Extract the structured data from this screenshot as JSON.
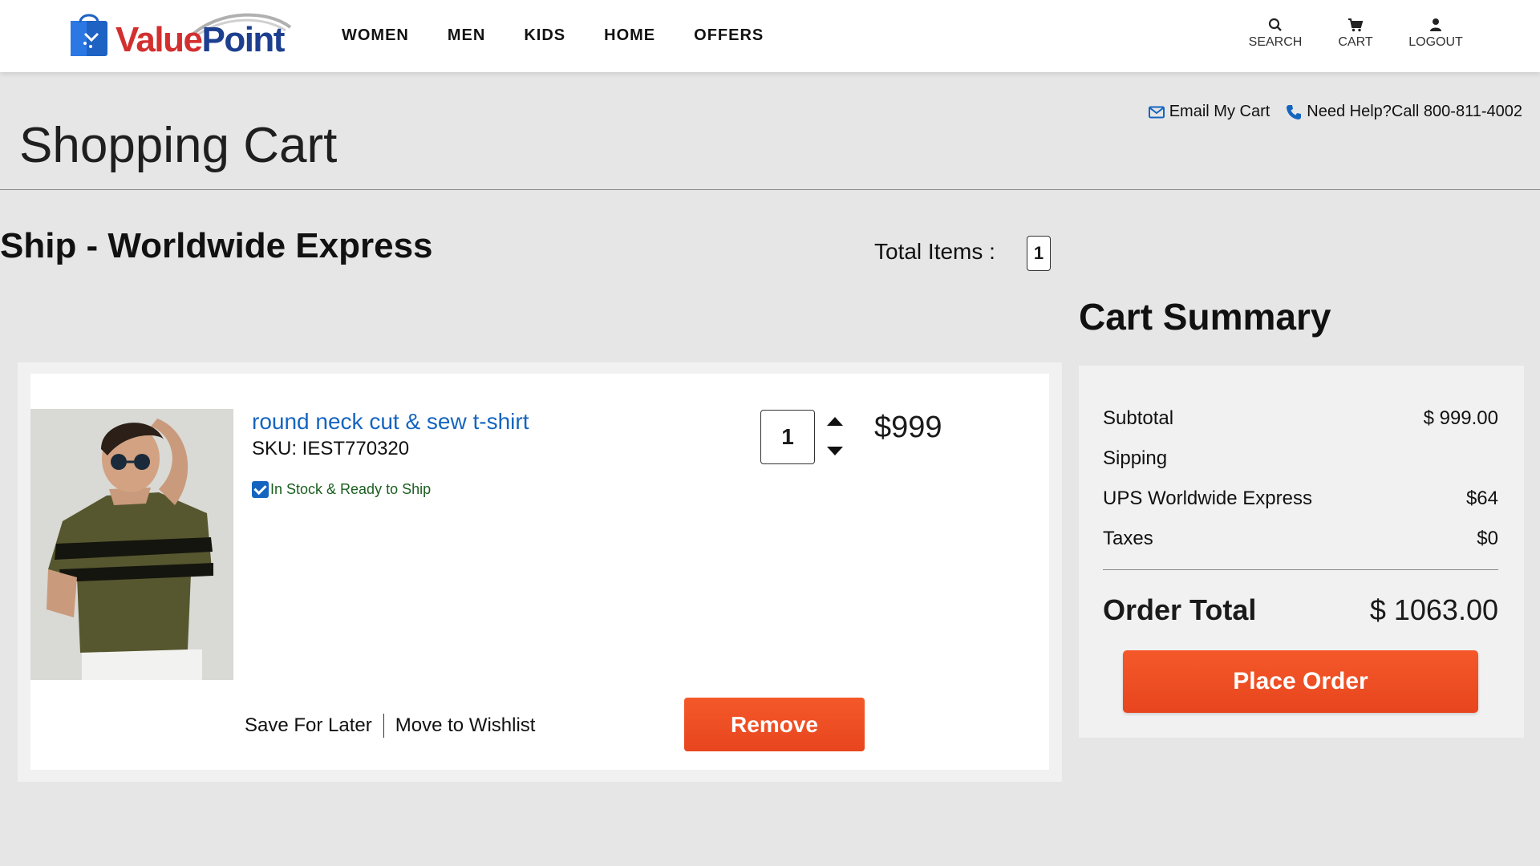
{
  "brand": {
    "name_part1": "Value",
    "name_part2": "Point"
  },
  "nav": {
    "items": [
      "WOMEN",
      "MEN",
      "KIDS",
      "HOME",
      "OFFERS"
    ]
  },
  "header_actions": {
    "search_label": "SEARCH",
    "cart_label": "CART",
    "logout_label": "LOGOUT"
  },
  "help": {
    "email_label": "Email My Cart",
    "call_label": "Need Help?Call 800-811-4002"
  },
  "page": {
    "title": "Shopping Cart"
  },
  "shipping": {
    "title": "Ship - Worldwide Express"
  },
  "total_items": {
    "label": "Total Items :",
    "count": "1"
  },
  "cart_item": {
    "name": "round neck cut & sew t-shirt",
    "sku": "SKU: IEST770320",
    "stock": "In Stock & Ready to Ship",
    "quantity": "1",
    "price": "$999",
    "save_for_later": "Save For Later",
    "move_to_wishlist": "Move to Wishlist",
    "remove_label": "Remove"
  },
  "summary": {
    "title": "Cart Summary",
    "rows": [
      {
        "label": "Subtotal",
        "value": "$ 999.00"
      },
      {
        "label": "Sipping",
        "value": ""
      },
      {
        "label": "UPS Worldwide Express",
        "value": "$64"
      },
      {
        "label": "Taxes",
        "value": "$0"
      }
    ],
    "order_total_label": "Order Total",
    "order_total_value": "$ 1063.00",
    "place_order_label": "Place Order"
  },
  "colors": {
    "accent_orange": "#f05a28",
    "link_blue": "#1565c0",
    "stock_green": "#1b5e20",
    "page_bg": "#e6e6e6"
  },
  "icons": [
    "search-icon",
    "cart-icon",
    "user-icon",
    "envelope-icon",
    "phone-icon",
    "chevron-up-icon",
    "chevron-down-icon",
    "checkbox-checked-icon"
  ]
}
